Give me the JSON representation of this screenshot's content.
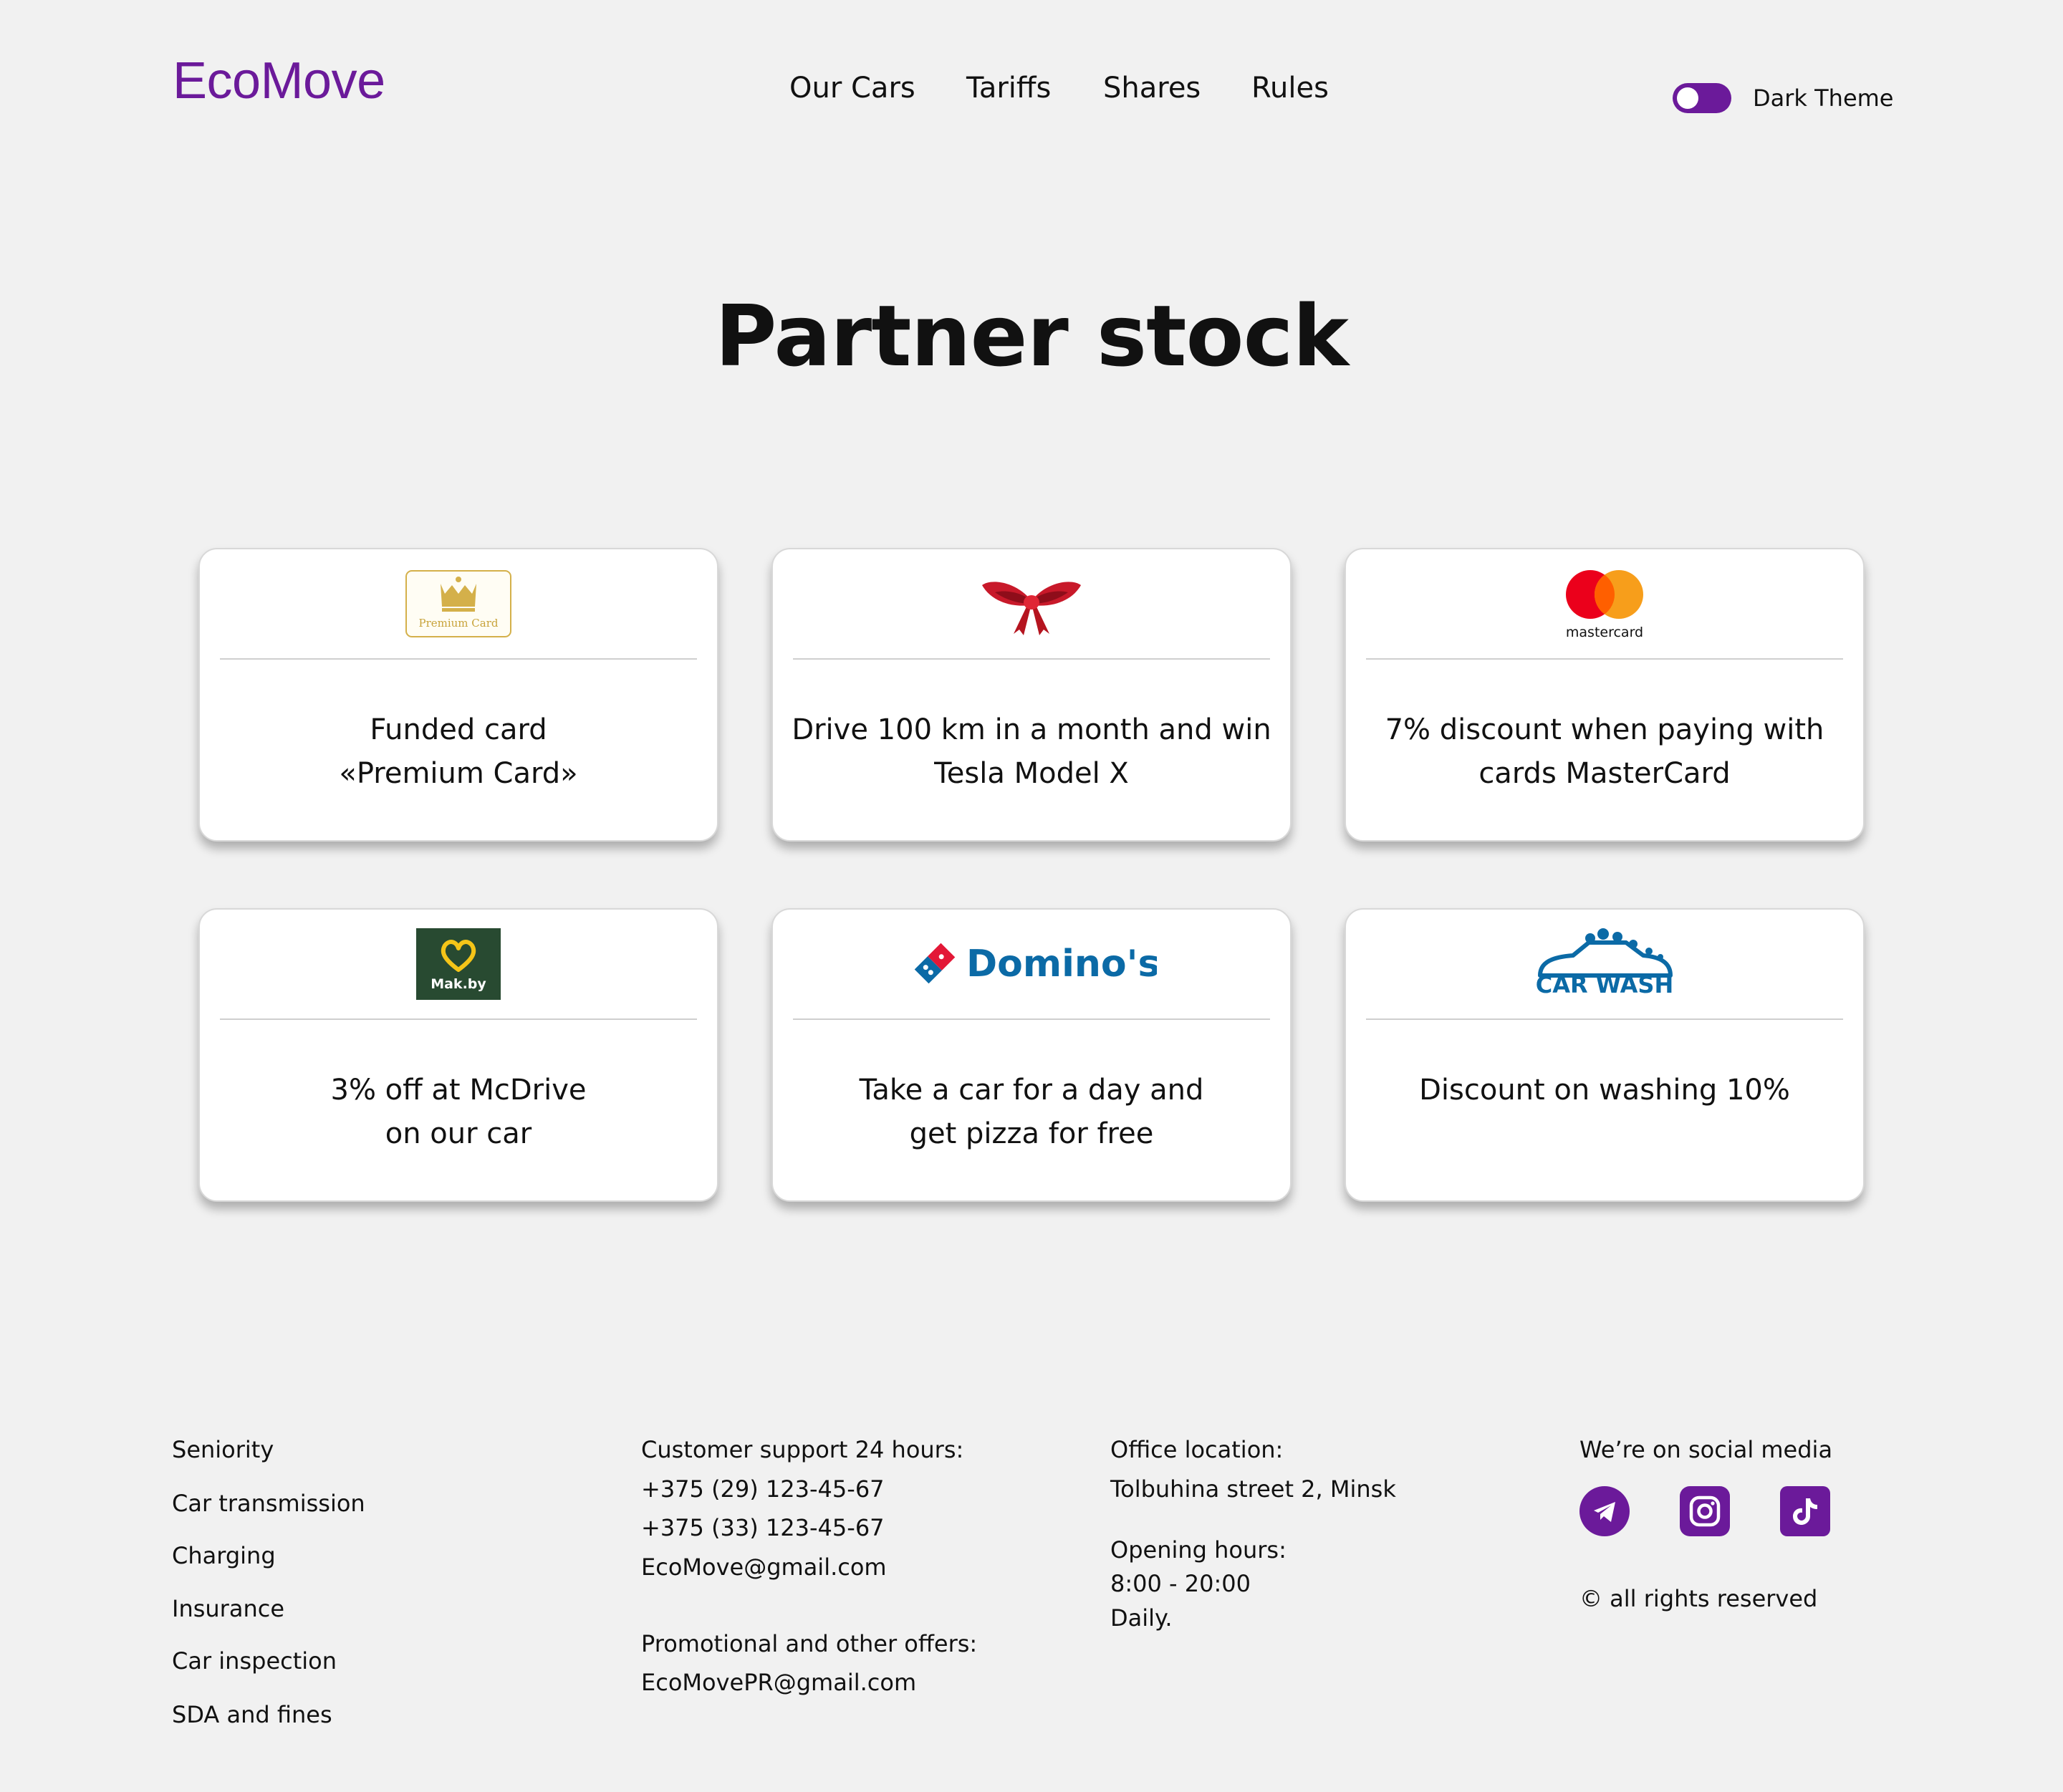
{
  "header": {
    "logo": "EcoMove",
    "nav": [
      "Our Cars",
      "Tariffs",
      "Shares",
      "Rules"
    ],
    "theme_toggle_label": "Dark Theme"
  },
  "main": {
    "title": "Partner stock",
    "cards": [
      {
        "logo": "Premium Card",
        "icon": "crown-icon",
        "text_line1": "Funded card",
        "text_line2": "«Premium Card»"
      },
      {
        "logo": "",
        "icon": "gift-bow-icon",
        "text_line1": "Drive 100 km in a month and win",
        "text_line2": "Tesla Model X"
      },
      {
        "logo": "mastercard",
        "icon": "mastercard-icon",
        "text_line1": "7% discount when paying with",
        "text_line2": "cards MasterCard"
      },
      {
        "logo": "Mak.by",
        "icon": "heart-icon",
        "text_line1": "3% off at McDrive",
        "text_line2": "on our car"
      },
      {
        "logo": "Domino's",
        "icon": "dominos-icon",
        "text_line1": "Take a car for a day and",
        "text_line2": "get pizza for free"
      },
      {
        "logo": "CAR WASH",
        "icon": "car-wash-icon",
        "text_line1": "Discount on washing 10%",
        "text_line2": ""
      }
    ]
  },
  "footer": {
    "links": [
      "Seniority",
      "Car transmission",
      "Charging",
      "Insurance",
      "Car inspection",
      "SDA and fines"
    ],
    "support": {
      "heading": "Customer support 24 hours:",
      "phone1": "+375 (29) 123-45-67",
      "phone2": "+375 (33) 123-45-67",
      "email": "EcoMove@gmail.com",
      "promo_heading": "Promotional and other offers:",
      "promo_email": "EcoMovePR@gmail.com"
    },
    "office": {
      "heading": "Office location:",
      "address": "Tolbuhina street 2, Minsk",
      "hours_heading": "Opening hours:",
      "hours": "8:00 - 20:00",
      "days": "Daily."
    },
    "social": {
      "heading": "We’re on social media",
      "icons": [
        "telegram-icon",
        "instagram-icon",
        "tiktok-icon"
      ],
      "copyright": "© all rights reserved"
    }
  },
  "colors": {
    "brand": "#6b1a9a",
    "background": "#f1f1f1",
    "card": "#ffffff"
  }
}
